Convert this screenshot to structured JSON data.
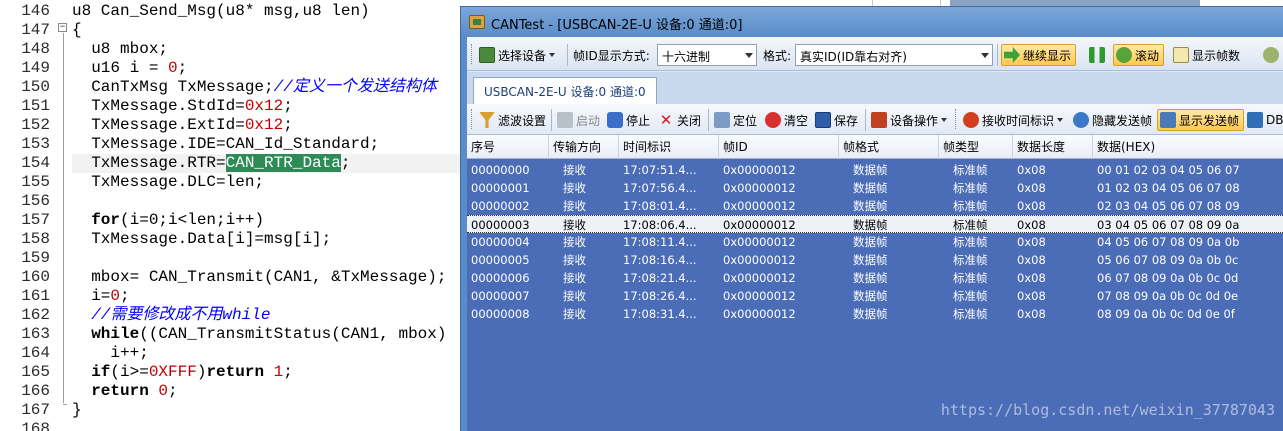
{
  "editor": {
    "lines": [
      {
        "n": "146",
        "segs": [
          {
            "t": "u8 Can_Send_Msg(u8* msg,u8 len)",
            "c": ""
          }
        ]
      },
      {
        "n": "147",
        "segs": [
          {
            "t": "{",
            "c": ""
          }
        ]
      },
      {
        "n": "148",
        "segs": [
          {
            "t": "  u8 mbox;",
            "c": ""
          }
        ]
      },
      {
        "n": "149",
        "segs": [
          {
            "t": "  u16 i = ",
            "c": ""
          },
          {
            "t": "0",
            "c": "num"
          },
          {
            "t": ";",
            "c": ""
          }
        ]
      },
      {
        "n": "150",
        "segs": [
          {
            "t": "  CanTxMsg TxMessage;",
            "c": ""
          },
          {
            "t": "//定义一个发送结构体",
            "c": "cmt"
          }
        ]
      },
      {
        "n": "151",
        "segs": [
          {
            "t": "  TxMessage.StdId=",
            "c": ""
          },
          {
            "t": "0x12",
            "c": "num"
          },
          {
            "t": ";",
            "c": ""
          }
        ]
      },
      {
        "n": "152",
        "segs": [
          {
            "t": "  TxMessage.ExtId=",
            "c": ""
          },
          {
            "t": "0x12",
            "c": "num"
          },
          {
            "t": ";",
            "c": ""
          }
        ]
      },
      {
        "n": "153",
        "segs": [
          {
            "t": "  TxMessage.IDE=CAN_Id_Standard;",
            "c": ""
          }
        ]
      },
      {
        "n": "154",
        "segs": [
          {
            "t": "  TxMessage.RTR=",
            "c": ""
          },
          {
            "t": "CAN_RTR_Data",
            "c": "sel"
          },
          {
            "t": ";",
            "c": ""
          }
        ]
      },
      {
        "n": "155",
        "segs": [
          {
            "t": "  TxMessage.DLC=len;",
            "c": ""
          }
        ]
      },
      {
        "n": "156",
        "segs": [
          {
            "t": "",
            "c": ""
          }
        ]
      },
      {
        "n": "157",
        "segs": [
          {
            "t": "  ",
            "c": ""
          },
          {
            "t": "for",
            "c": "kw"
          },
          {
            "t": "(i=0;i<len;i++)",
            "c": ""
          }
        ]
      },
      {
        "n": "158",
        "segs": [
          {
            "t": "  TxMessage.Data[i]=msg[i];",
            "c": ""
          }
        ]
      },
      {
        "n": "159",
        "segs": [
          {
            "t": "",
            "c": ""
          }
        ]
      },
      {
        "n": "160",
        "segs": [
          {
            "t": "  mbox= CAN_Transmit(CAN1, &TxMessage);",
            "c": ""
          }
        ]
      },
      {
        "n": "161",
        "segs": [
          {
            "t": "  i=",
            "c": ""
          },
          {
            "t": "0",
            "c": "num"
          },
          {
            "t": ";",
            "c": ""
          }
        ]
      },
      {
        "n": "162",
        "segs": [
          {
            "t": "  ",
            "c": ""
          },
          {
            "t": "//需要修改成不用while",
            "c": "cmt"
          }
        ]
      },
      {
        "n": "163",
        "segs": [
          {
            "t": "  ",
            "c": ""
          },
          {
            "t": "while",
            "c": "kw"
          },
          {
            "t": "((CAN_TransmitStatus(CAN1, mbox)",
            "c": ""
          }
        ]
      },
      {
        "n": "164",
        "segs": [
          {
            "t": "    i++;",
            "c": ""
          }
        ]
      },
      {
        "n": "165",
        "segs": [
          {
            "t": "  ",
            "c": ""
          },
          {
            "t": "if",
            "c": "kw"
          },
          {
            "t": "(i>=",
            "c": ""
          },
          {
            "t": "0XFFF",
            "c": "num"
          },
          {
            "t": ")",
            "c": ""
          },
          {
            "t": "return",
            "c": "kw"
          },
          {
            "t": " ",
            "c": ""
          },
          {
            "t": "1",
            "c": "num"
          },
          {
            "t": ";",
            "c": ""
          }
        ]
      },
      {
        "n": "166",
        "segs": [
          {
            "t": "  ",
            "c": ""
          },
          {
            "t": "return",
            "c": "kw"
          },
          {
            "t": " ",
            "c": ""
          },
          {
            "t": "0",
            "c": "num"
          },
          {
            "t": ";",
            "c": ""
          }
        ]
      },
      {
        "n": "167",
        "segs": [
          {
            "t": "}",
            "c": ""
          }
        ]
      },
      {
        "n": "168",
        "segs": [
          {
            "t": "",
            "c": ""
          }
        ]
      }
    ],
    "highlighted_line": "154"
  },
  "window": {
    "title": "CANTest  - [USBCAN-2E-U 设备:0 通道:0]"
  },
  "toolbar1": {
    "select_device": "选择设备",
    "frame_id_format_label": "帧ID显示方式:",
    "frame_id_format_value": "十六进制",
    "format_label": "格式:",
    "format_value": "真实ID(ID靠右对齐)",
    "continue_display": "继续显示",
    "scroll": "滚动",
    "show_frame_count": "显示帧数"
  },
  "tab": {
    "label": "USBCAN-2E-U 设备:0 通道:0"
  },
  "toolbar2": {
    "filter_settings": "滤波设置",
    "start": "启动",
    "stop": "停止",
    "close": "关闭",
    "locate": "定位",
    "clear": "清空",
    "save": "保存",
    "device_ops": "设备操作",
    "rx_time_flag": "接收时间标识",
    "hide_tx_frames": "隐藏发送帧",
    "show_tx_frames": "显示发送帧",
    "db": "DB"
  },
  "table": {
    "columns": [
      "序号",
      "传输方向",
      "时间标识",
      "帧ID",
      "帧格式",
      "帧类型",
      "数据长度",
      "数据(HEX)"
    ],
    "rows": [
      [
        "00000000",
        "接收",
        "17:07:51.4...",
        "0x00000012",
        "数据帧",
        "标准帧",
        "0x08",
        "00 01 02 03 04 05 06 07"
      ],
      [
        "00000001",
        "接收",
        "17:07:56.4...",
        "0x00000012",
        "数据帧",
        "标准帧",
        "0x08",
        "01 02 03 04 05 06 07 08"
      ],
      [
        "00000002",
        "接收",
        "17:08:01.4...",
        "0x00000012",
        "数据帧",
        "标准帧",
        "0x08",
        "02 03 04 05 06 07 08 09"
      ],
      [
        "00000003",
        "接收",
        "17:08:06.4...",
        "0x00000012",
        "数据帧",
        "标准帧",
        "0x08",
        "03 04 05 06 07 08 09 0a"
      ],
      [
        "00000004",
        "接收",
        "17:08:11.4...",
        "0x00000012",
        "数据帧",
        "标准帧",
        "0x08",
        "04 05 06 07 08 09 0a 0b"
      ],
      [
        "00000005",
        "接收",
        "17:08:16.4...",
        "0x00000012",
        "数据帧",
        "标准帧",
        "0x08",
        "05 06 07 08 09 0a 0b 0c"
      ],
      [
        "00000006",
        "接收",
        "17:08:21.4...",
        "0x00000012",
        "数据帧",
        "标准帧",
        "0x08",
        "06 07 08 09 0a 0b 0c 0d"
      ],
      [
        "00000007",
        "接收",
        "17:08:26.4...",
        "0x00000012",
        "数据帧",
        "标准帧",
        "0x08",
        "07 08 09 0a 0b 0c 0d 0e"
      ],
      [
        "00000008",
        "接收",
        "17:08:31.4...",
        "0x00000012",
        "数据帧",
        "标准帧",
        "0x08",
        "08 09 0a 0b 0c 0d 0e 0f"
      ]
    ],
    "selected_row": "00000003"
  },
  "watermark": "https://blog.csdn.net/weixin_37787043",
  "colors": {
    "grid_bg": "#4b6cb7",
    "selection_green": "#2e8b57",
    "keyword_number": "#c00000",
    "comment_blue": "#0000ff"
  }
}
